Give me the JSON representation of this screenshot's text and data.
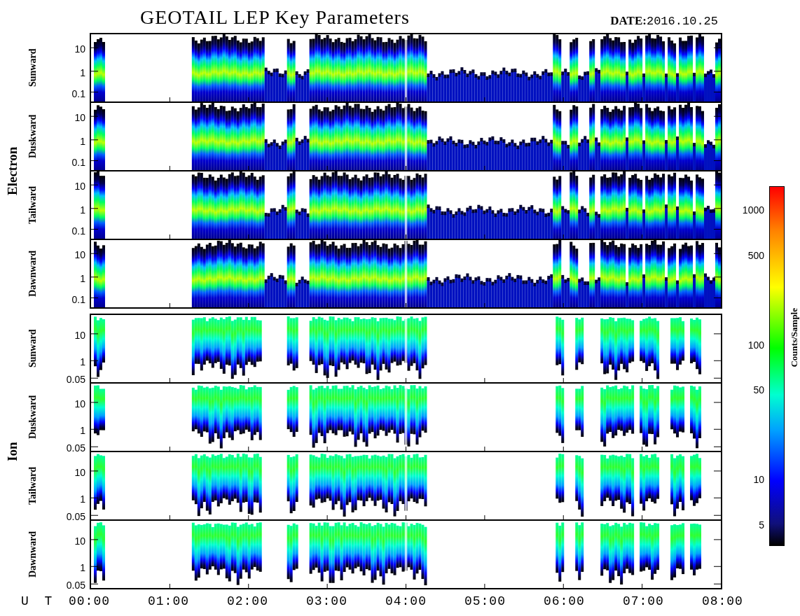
{
  "title": "GEOTAIL LEP Key Parameters",
  "date_label": "DATE:",
  "date": "2016.10.25",
  "groups": [
    {
      "label": "Electron",
      "kind": "electron",
      "panels": [
        {
          "label": "Sunward",
          "yticks": [
            "10",
            "1",
            "0.1"
          ]
        },
        {
          "label": "Duskward",
          "yticks": [
            "10",
            "1",
            "0.1"
          ]
        },
        {
          "label": "Tailward",
          "yticks": [
            "10",
            "1",
            "0.1"
          ]
        },
        {
          "label": "Dawnward",
          "yticks": [
            "10",
            "1",
            "0.1"
          ]
        }
      ]
    },
    {
      "label": "Ion",
      "kind": "ion",
      "panels": [
        {
          "label": "Sunward",
          "yticks": [
            "10",
            "1",
            "0.05"
          ]
        },
        {
          "label": "Duskward",
          "yticks": [
            "10",
            "1",
            "0.05"
          ]
        },
        {
          "label": "Tailward",
          "yticks": [
            "10",
            "1",
            "0.05"
          ]
        },
        {
          "label": "Dawnward",
          "yticks": [
            "10",
            "1",
            "0.05"
          ]
        }
      ]
    }
  ],
  "x_axis": {
    "label": "U T",
    "ticks": [
      "00:00",
      "01:00",
      "02:00",
      "03:00",
      "04:00",
      "05:00",
      "06:00",
      "07:00",
      "08:00"
    ]
  },
  "colorbar": {
    "title": "Counts/Sample",
    "ticks": [
      "1000",
      "500",
      "100",
      "50",
      "10",
      "5"
    ]
  }
}
